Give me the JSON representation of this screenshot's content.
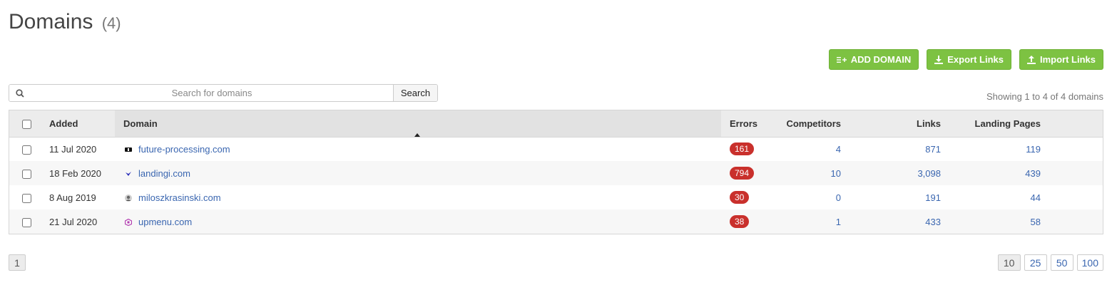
{
  "header": {
    "title": "Domains",
    "count": "(4)"
  },
  "actions": {
    "add_domain": "ADD DOMAIN",
    "export_links": "Export Links",
    "import_links": "Import Links"
  },
  "search": {
    "placeholder": "Search for domains",
    "value": "",
    "button": "Search"
  },
  "summary": "Showing 1 to 4 of 4 domains",
  "table": {
    "columns": [
      "Added",
      "Domain",
      "Errors",
      "Competitors",
      "Links",
      "Landing Pages"
    ],
    "rows": [
      {
        "added": "11 Jul 2020",
        "domain": "future-processing.com",
        "errors": "161",
        "competitors": "4",
        "links": "871",
        "landing_pages": "119",
        "favicon": "future-processing-logo"
      },
      {
        "added": "18 Feb 2020",
        "domain": "landingi.com",
        "errors": "794",
        "competitors": "10",
        "links": "3,098",
        "landing_pages": "439",
        "favicon": "landingi-logo"
      },
      {
        "added": "8 Aug 2019",
        "domain": "miloszkrasinski.com",
        "errors": "30",
        "competitors": "0",
        "links": "191",
        "landing_pages": "44",
        "favicon": "person-avatar"
      },
      {
        "added": "21 Jul 2020",
        "domain": "upmenu.com",
        "errors": "38",
        "competitors": "1",
        "links": "433",
        "landing_pages": "58",
        "favicon": "upmenu-logo"
      }
    ]
  },
  "pagination": {
    "current_page": "1",
    "page_sizes": [
      "10",
      "25",
      "50",
      "100"
    ],
    "selected_size": "10"
  },
  "colors": {
    "accent_green": "#7dc242",
    "error_red": "#c9302c",
    "link_blue": "#3a66b0"
  }
}
